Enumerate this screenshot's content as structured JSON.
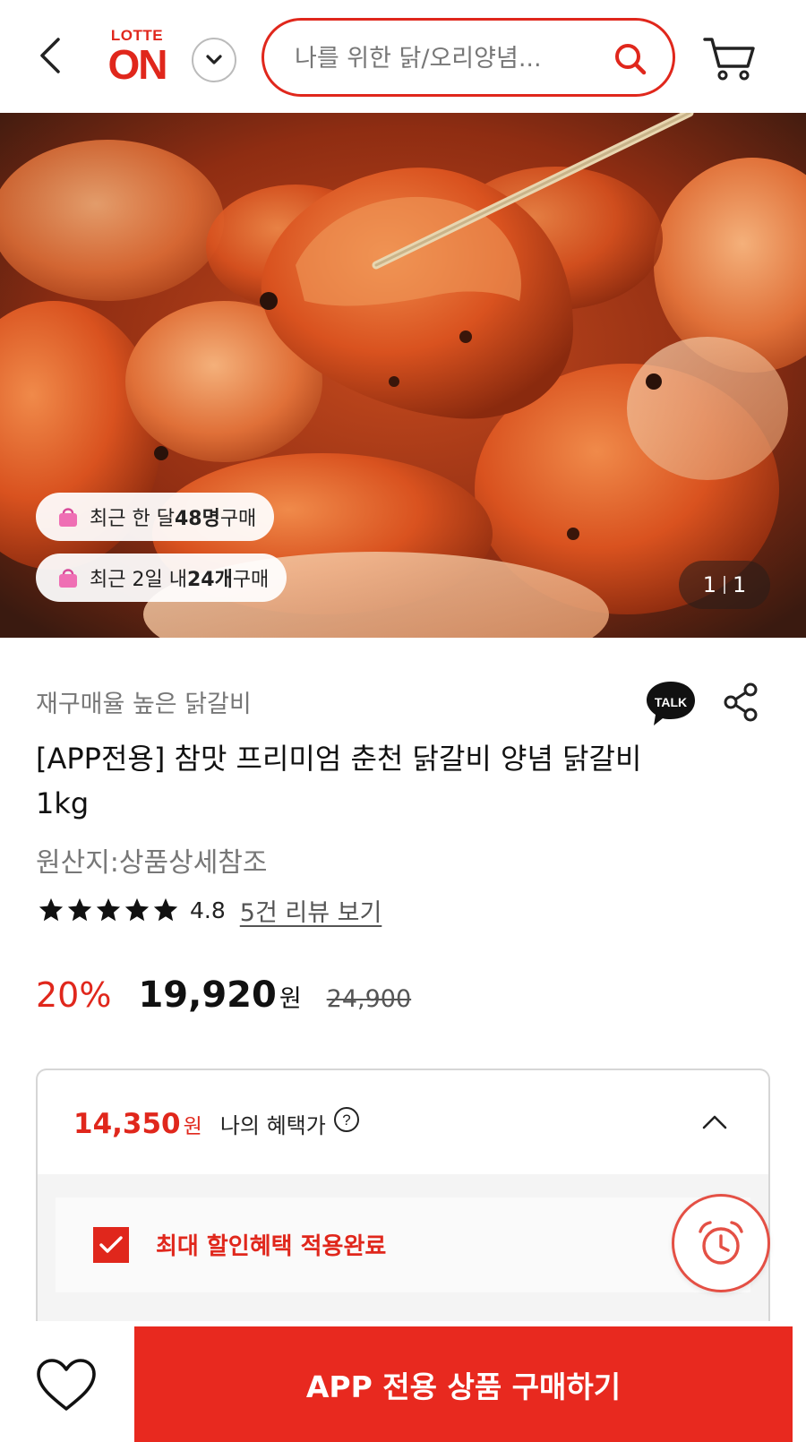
{
  "header": {
    "logo_top": "LOTTE",
    "logo_bottom": "ON",
    "search_placeholder": "나를 위한 닭/오리양념...",
    "icons": [
      "back-icon",
      "chevron-down-icon",
      "search-icon",
      "cart-icon"
    ]
  },
  "hero": {
    "badges": [
      {
        "prefix": "최근 한 달 ",
        "highlight": "48명",
        "suffix": " 구매"
      },
      {
        "prefix": "최근 2일 내 ",
        "highlight": "24개",
        "suffix": " 구매"
      }
    ],
    "page_current": "1",
    "page_total": "1"
  },
  "product": {
    "category": "재구매율 높은 닭갈비",
    "talk_label": "TALK",
    "title": "[APP전용] 참맛 프리미엄 춘천 닭갈비 양념 닭갈비 1kg",
    "origin": "원산지:상품상세참조",
    "rating_value": "4.8",
    "rating_stars": 5,
    "review_link": "5건 리뷰 보기",
    "discount": "20%",
    "price": "19,920",
    "currency": "원",
    "original_price": "24,900"
  },
  "benefit": {
    "price": "14,350",
    "currency": "원",
    "label": "나의 혜택가",
    "applied_text": "최대 할인혜택 적용완료"
  },
  "bottom": {
    "buy_label": "APP 전용 상품 구매하기"
  },
  "colors": {
    "brand_red": "#e0271c",
    "buy_button": "#e8291f"
  }
}
